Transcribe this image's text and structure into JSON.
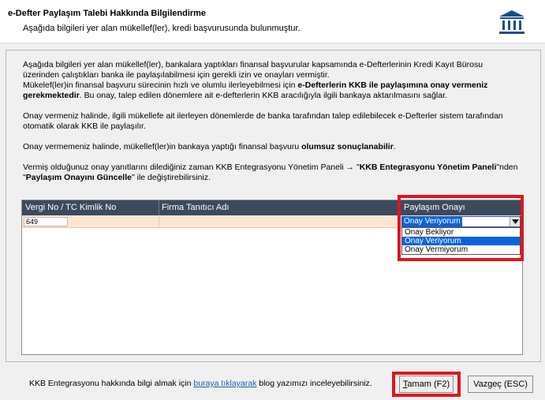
{
  "header": {
    "title": "e-Defter Paylaşım Talebi Hakkında Bilgilendirme",
    "subtitle": "Aşağıda bilgileri yer alan mükellef(ler), kredi başvurusunda bulunmuştur."
  },
  "info": {
    "p1_line1": "Aşağıda bilgileri yer alan mükellef(ler), bankalara yaptıkları finansal başvurular kapsamında e-Defterlerinin Kredi Kayıt Bürosu",
    "p1_line2": "üzerinden çalıştıkları banka ile paylaşılabilmesi için gerekli izin ve onayları vermiştir.",
    "p2_pre": "Mükelef(ler)in finansal başvuru sürecinin hızlı ve olumlu ilerleyebilmesi için ",
    "p2_bold": "e-Defterlerin KKB ile paylaşımına onay vermeniz gerekmektedir",
    "p2_post": ". Bu onay, talep edilen dönemlere ait e-defterlerin KKB aracılığıyla ilgili bankaya aktarılmasını sağlar.",
    "p3": "Onay vermeniz halinde, ilgili mükellefe ait ilerleyen dönemlerde de banka tarafından talep edilebilecek e-Defterler sistem tarafından otomatik olarak KKB ile paylaşılır.",
    "p4_pre": "Onay vermemeniz halinde, mükellef(ler)in bankaya yaptığı finansal başvuru ",
    "p4_bold": "olumsuz sonuçlanabilir",
    "p4_post": ".",
    "p5_pre": "Vermiş olduğunuz onay yanıtlarını dilediğiniz zaman KKB Entegrasyonu Yönetim Paneli → \"",
    "p5_bold1": "KKB Entegrasyonu Yönetim Paneli",
    "p5_mid": "\"nden \"",
    "p5_bold2": "Paylaşım Onayını Güncelle",
    "p5_post": "\" ile değiştirebilirsiniz."
  },
  "grid": {
    "columns": [
      "Vergi No / TC Kimlik No",
      "Firma Tanıtıcı Adı",
      "Paylaşım Onayı"
    ],
    "row": {
      "vergi_no": "649",
      "firma": "",
      "onay": "Onay Veriyorum"
    },
    "dropdown_options": [
      "Onay Bekliyor",
      "Onay Veriyorum",
      "Onay Vermiyorum"
    ],
    "selected_option": "Onay Veriyorum"
  },
  "footer": {
    "text_pre": "KKB Entegrasyonu hakkında bilgi almak için ",
    "link": "buraya tıklayarak",
    "text_post": " blog yazımızı inceleyebilirsiniz."
  },
  "buttons": {
    "ok_underlined": "T",
    "ok_rest": "amam (F2)",
    "cancel": "Vazgeç (ESC)"
  },
  "colors": {
    "highlight": "#e0161b",
    "grid_header": "#3c4a5e",
    "row_background": "#fbe5d3",
    "selection": "#0a64d6",
    "link": "#1a5fb4"
  },
  "icons": {
    "header_icon": "bank-icon",
    "dropdown_arrow": "chevron-down-icon"
  }
}
